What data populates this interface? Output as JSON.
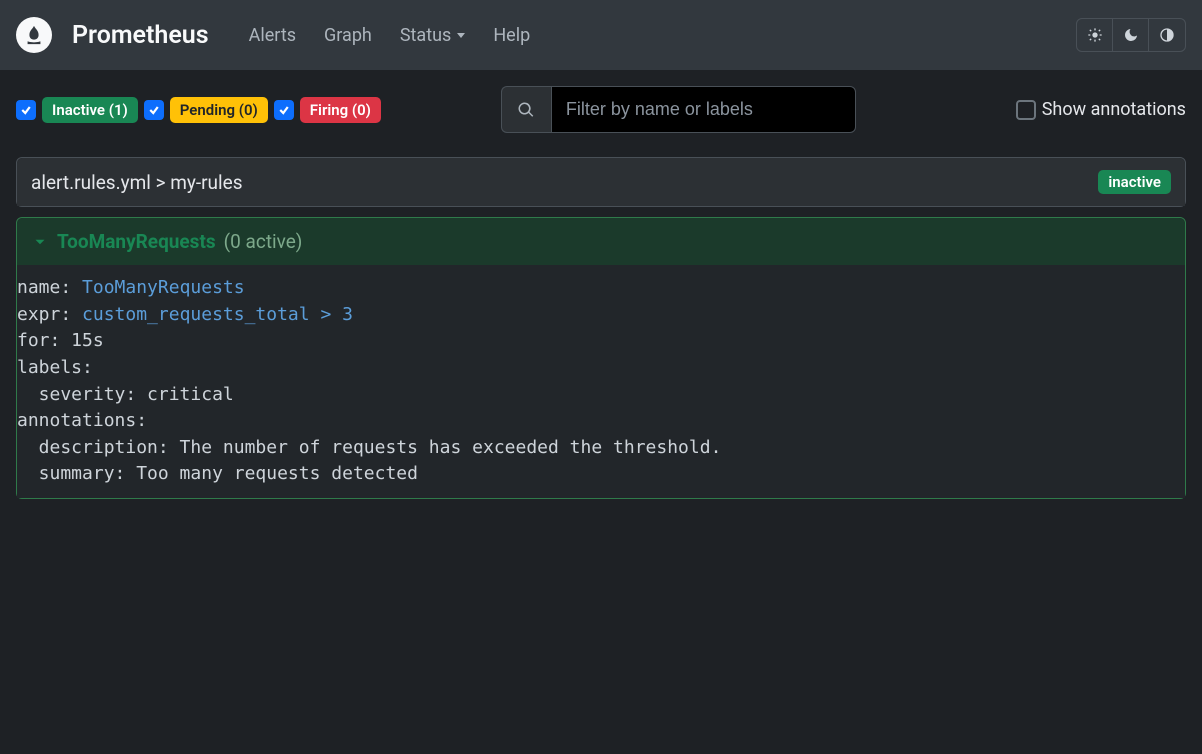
{
  "header": {
    "brand": "Prometheus",
    "nav": {
      "alerts": "Alerts",
      "graph": "Graph",
      "status": "Status",
      "help": "Help"
    }
  },
  "filters": {
    "inactive_label": "Inactive (1)",
    "pending_label": "Pending (0)",
    "firing_label": "Firing (0)"
  },
  "search": {
    "placeholder": "Filter by name or labels"
  },
  "annotations_toggle": "Show annotations",
  "group": {
    "path": "alert.rules.yml > my-rules",
    "state": "inactive"
  },
  "alert": {
    "name": "TooManyRequests",
    "count_text": "(0 active)",
    "rule": {
      "name_key": "name: ",
      "name_val": "TooManyRequests",
      "expr_key": "expr: ",
      "expr_val": "custom_requests_total > 3",
      "for_line": "for: 15s",
      "labels_line": "labels:",
      "severity_line": "  severity: critical",
      "annotations_line": "annotations:",
      "description_line": "  description: The number of requests has exceeded the threshold.",
      "summary_line": "  summary: Too many requests detected"
    }
  }
}
